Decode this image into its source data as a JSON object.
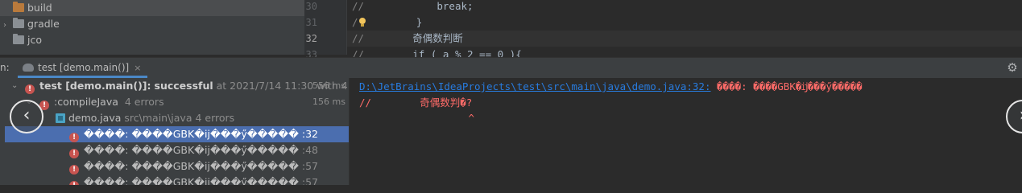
{
  "project_tree": {
    "items": [
      {
        "label": "build",
        "folder_color": "#b97a3c",
        "expandable": false
      },
      {
        "label": "gradle",
        "folder_color": "#8a8f94",
        "expandable": true
      },
      {
        "label": "jco",
        "folder_color": "#8a8f94",
        "expandable": false
      }
    ]
  },
  "editor": {
    "line_numbers": [
      "30",
      "31",
      "32",
      "33"
    ],
    "current_line": "32",
    "lines": [
      {
        "prefix": "//",
        "code": "            break;"
      },
      {
        "prefix": "/",
        "code": "        }"
      },
      {
        "prefix": "//",
        "code": "        奇偶数判断"
      },
      {
        "prefix": "//",
        "code": "        if ( a % 2 == 0 ){"
      }
    ]
  },
  "run_bar": {
    "label": "n:",
    "tab_label": "test [demo.main()]",
    "close_glyph": "×",
    "settings_icon": "gear-icon"
  },
  "run_tree": {
    "root": {
      "label": "test [demo.main()]:",
      "status": "successful",
      "detail": "at 2021/7/14 11:30 with 4 e",
      "time": "556 ms"
    },
    "task": {
      "label": ":compileJava",
      "count": "4 errors",
      "time": "156 ms"
    },
    "file": {
      "label": "demo.java",
      "path": "src\\main\\java",
      "count": "4 errors"
    },
    "errors": [
      {
        "text": "����: ����GBK�ĳ���ӳ�����",
        "line": ":32",
        "selected": true
      },
      {
        "text": "����: ����GBK�ĳ���ӳ�����",
        "line": ":48",
        "selected": false
      },
      {
        "text": "����: ����GBK�ĳ���ӳ�����",
        "line": ":57",
        "selected": false
      },
      {
        "text": "����: ����GBK�ĳ���ӳ�����",
        "line": ":57",
        "selected": false
      }
    ]
  },
  "output": {
    "link": "D:\\JetBrains\\IdeaProjects\\test\\src\\main\\java\\demo.java:32:",
    "message": " ����: ����GBK�ĳ���ӳ�����",
    "code_line": "//        奇偶数判�?",
    "caret": "                  ^"
  },
  "nav": {
    "prev_glyph": "‹",
    "next_glyph": "›"
  },
  "colors": {
    "accent": "#4a88c7",
    "error": "#c75450",
    "selection": "#4b6eaf",
    "link": "#287bde"
  }
}
